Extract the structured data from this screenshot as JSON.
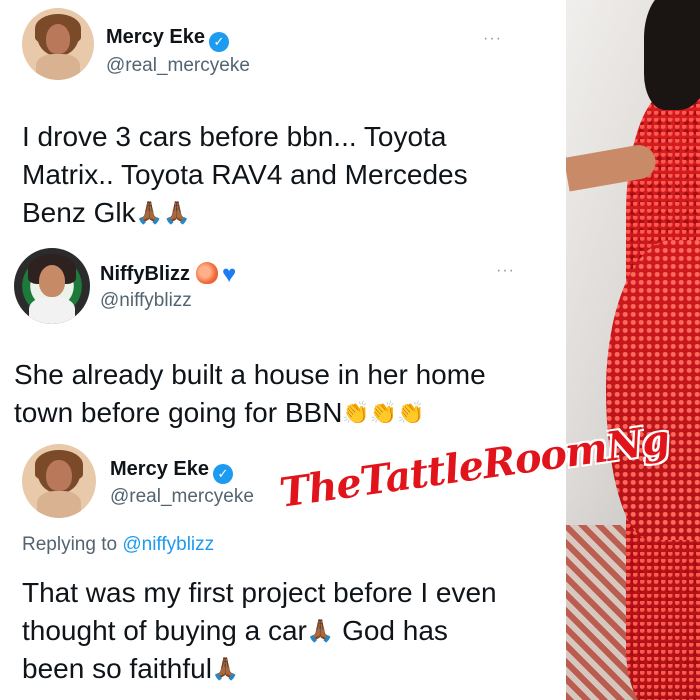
{
  "tweets": [
    {
      "name": "Mercy Eke",
      "handle": "@real_mercyeke",
      "verified_icon": "verified-badge",
      "more": "···",
      "text_lines": [
        "I drove 3 cars before bbn... Toyota",
        "Matrix.. Toyota RAV4 and Mercedes",
        "Benz Glk"
      ],
      "emoji": [
        "🙏🏾",
        "🙏🏾"
      ]
    },
    {
      "name": "NiffyBlizz",
      "handle": "@niffyblizz",
      "name_emoji": [
        "🍑",
        "💙"
      ],
      "more": "···",
      "text_lines": [
        "She already built a house in her home",
        "town before going for BBN"
      ],
      "emoji": [
        "👏",
        "👏",
        "👏"
      ]
    },
    {
      "name": "Mercy Eke",
      "handle": "@real_mercyeke",
      "verified_icon": "verified-badge",
      "replying_prefix": "Replying to",
      "replying_mention": "@niffyblizz",
      "text_lines": [
        "That was my first project before I even",
        "thought of buying a car",
        "God has",
        "been so faithful"
      ],
      "emoji": [
        "🙏🏾",
        "🙏🏾"
      ]
    }
  ],
  "watermark": "TheTattleRoomNg",
  "colors": {
    "verified": "#1d9bf0",
    "mention": "#1d9bf0",
    "watermark": "#e0141a",
    "dress": "#d81d22"
  }
}
